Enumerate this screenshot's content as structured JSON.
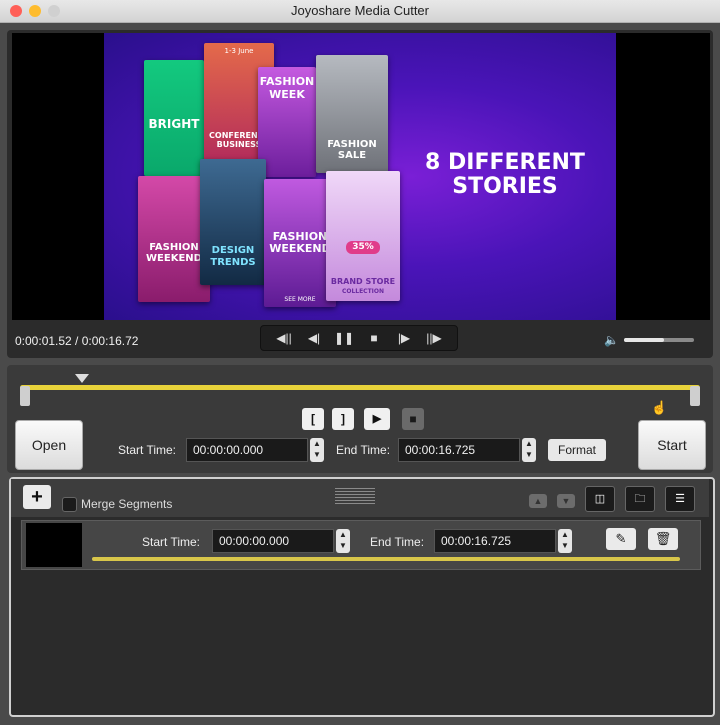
{
  "window": {
    "title": "Joyoshare Media Cutter",
    "traffic_lights": [
      {
        "name": "close",
        "color": "#ff5f57"
      },
      {
        "name": "minimize",
        "color": "#febc2e"
      },
      {
        "name": "zoom",
        "color": "#d0d0d0"
      }
    ]
  },
  "video": {
    "headline_line1": "8 DIFFERENT",
    "headline_line2": "STORIES",
    "cards": [
      {
        "caption": "BRIGHT",
        "color": "#1fd6a0"
      },
      {
        "caption": "CONFERENCE BUSINESS",
        "color": "#e0505f"
      },
      {
        "caption": "FASHION WEEK",
        "color": "#b14fd8"
      },
      {
        "caption": "FASHION SALE",
        "color": "#9aa0a8"
      },
      {
        "caption": "FASHION WEEKEND",
        "color": "#c23a8f"
      },
      {
        "caption": "DESIGN TRENDS",
        "color": "#2a4a70"
      },
      {
        "caption": "FASHION WEEKEND",
        "color": "#9030b8"
      },
      {
        "caption": "35%",
        "color": "#d49be8"
      },
      {
        "caption": "BRAND STORE",
        "color": "#d49be8"
      },
      {
        "caption": "COLLECTION",
        "color": "#d49be8"
      },
      {
        "caption": "SEE MORE",
        "color": "#9030b8"
      },
      {
        "caption": "1-3 June",
        "color": "#e0505f"
      }
    ]
  },
  "player": {
    "timecode": "0:00:01.52 / 0:00:16.72",
    "volume_level": 0.57,
    "playhead_position": 0.091
  },
  "transport": [
    {
      "name": "previous-segment-icon",
      "glyph": "◀||"
    },
    {
      "name": "step-back-icon",
      "glyph": "◀|"
    },
    {
      "name": "pause-icon",
      "glyph": "❚❚"
    },
    {
      "name": "stop-icon",
      "glyph": "■"
    },
    {
      "name": "step-forward-icon",
      "glyph": "|▶"
    },
    {
      "name": "next-segment-icon",
      "glyph": "||▶"
    }
  ],
  "edit": {
    "open_label": "Open",
    "start_label": "Start",
    "start_time_label": "Start Time:",
    "start_time_value": "00:00:00.000",
    "end_time_label": "End Time:",
    "end_time_value": "00:00:16.725",
    "format_label": "Format",
    "mark_in_glyph": "[",
    "mark_out_glyph": "]"
  },
  "segments": {
    "merge_label": "Merge Segments",
    "add_glyph": "+",
    "items": [
      {
        "start_time_label": "Start Time:",
        "start_time_value": "00:00:00.000",
        "end_time_label": "End Time:",
        "end_time_value": "00:00:16.725"
      }
    ]
  }
}
